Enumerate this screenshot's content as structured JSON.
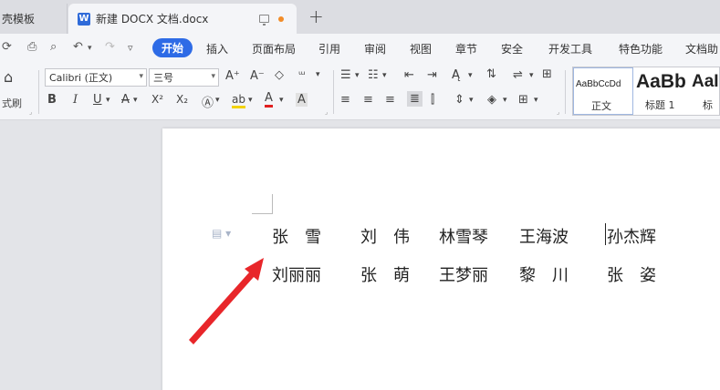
{
  "tabs": {
    "prev_label": "壳模板",
    "active_label": "新建 DOCX 文档.docx",
    "doc_icon": "W",
    "new_tab": "+"
  },
  "quick_access": [
    "ᕈ",
    "⎙",
    "🔍",
    "↶",
    "↷",
    "▿"
  ],
  "menu": {
    "active": "开始",
    "items": [
      "插入",
      "页面布局",
      "引用",
      "审阅",
      "视图",
      "章节",
      "安全",
      "开发工具",
      "特色功能",
      "文档助"
    ]
  },
  "toolbar": {
    "format_painter_label": "式刷",
    "font_name": "Calibri (正文)",
    "font_size": "三号",
    "grow_font": "A⁺",
    "shrink_font": "A⁻",
    "bold": "B",
    "italic": "I",
    "underline": "U",
    "strike": "A",
    "superscript": "X²",
    "subscript": "X₂",
    "font_color": "A",
    "char_shading": "A",
    "highlight": "ab"
  },
  "styles": [
    {
      "sample": "AaBbCcDd",
      "label": "正文"
    },
    {
      "sample": "AaBb",
      "label": "标题 1"
    },
    {
      "sample": "AaI",
      "label": "标题"
    }
  ],
  "document": {
    "row1": [
      "张　雪",
      "刘　伟",
      "林雪琴",
      "王海波",
      "孙杰辉"
    ],
    "row2": [
      "刘丽丽",
      "张　萌",
      "王梦丽",
      "黎　川",
      "张　姿"
    ]
  },
  "colors": {
    "accent": "#2e6be6",
    "annotation_arrow": "#e8262a"
  }
}
